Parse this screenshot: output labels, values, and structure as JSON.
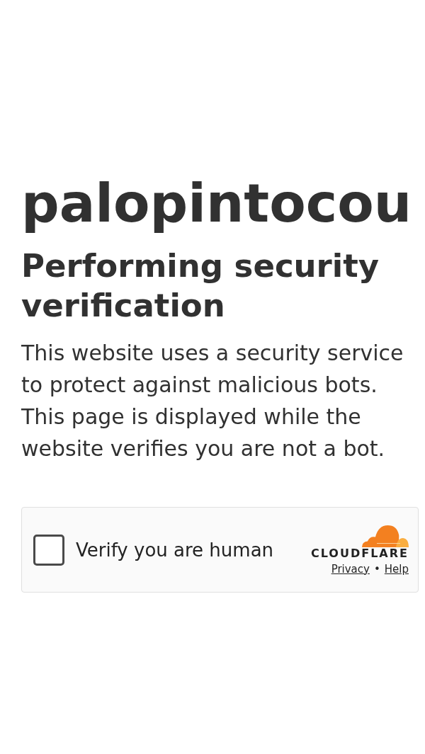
{
  "site": {
    "title": "palopintocou"
  },
  "challenge": {
    "heading": "Performing security verification",
    "message": "This website uses a security service to protect against malicious bots. This page is displayed while the website verifies you are not a bot."
  },
  "widget": {
    "checkbox": {
      "label": "Verify you are human",
      "checked": false
    },
    "brand": {
      "wordmark": "CLOUDFLARE",
      "links": [
        {
          "label": "Privacy"
        },
        {
          "label": "Help"
        }
      ],
      "separator": "•"
    }
  }
}
